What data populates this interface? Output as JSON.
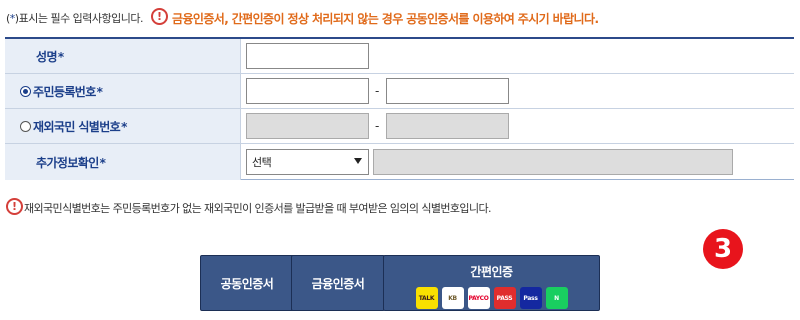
{
  "notes": {
    "required_prefix": "(",
    "required_star": "*",
    "required_suffix": ")표시는 필수 입력사항입니다.",
    "top_warning": "금융인증서, 간편인증이 정상 처리되지 않는 경우 공동인증서를 이용하여 주시기 바랍니다.",
    "bottom_warning": "재외국민식별번호는 주민등록번호가 없는 재외국민이 인증서를 발급받을 때 부여받은 임의의 식별번호입니다.",
    "warning_glyph": "!"
  },
  "form": {
    "name": {
      "label": "성명",
      "star": "*",
      "value": ""
    },
    "resident_number": {
      "label": "주민등록번호",
      "star": "*",
      "selected": true,
      "dash": "-",
      "front": "",
      "back": ""
    },
    "overseas_number": {
      "label": "재외국민 식별번호",
      "star": "*",
      "selected": false,
      "dash": "-",
      "front": "",
      "back": ""
    },
    "extra_info": {
      "label": "추가정보확인",
      "star": "*",
      "select_value": "선택",
      "input_value": ""
    }
  },
  "buttons": {
    "joint_cert": "공동인증서",
    "financial_cert": "금융인증서",
    "simple_auth": "간편인증",
    "providers": [
      {
        "name": "TALK",
        "bg": "#f9e000",
        "fg": "#3a1d1d"
      },
      {
        "name": "KB",
        "bg": "#ffffff",
        "fg": "#6e5a2b"
      },
      {
        "name": "PAYCO",
        "bg": "#ffffff",
        "fg": "#e4002b"
      },
      {
        "name": "PASS",
        "bg": "#e02d2d",
        "fg": "#ffffff"
      },
      {
        "name": "Pass",
        "bg": "#1428a0",
        "fg": "#ffffff"
      },
      {
        "name": "N",
        "bg": "#19ce60",
        "fg": "#ffffff"
      }
    ]
  },
  "step_badge": "3",
  "colors": {
    "accent": "#1c3f8a",
    "warning": "#e06a1a",
    "button": "#3b5788",
    "badge": "#e8141c"
  }
}
